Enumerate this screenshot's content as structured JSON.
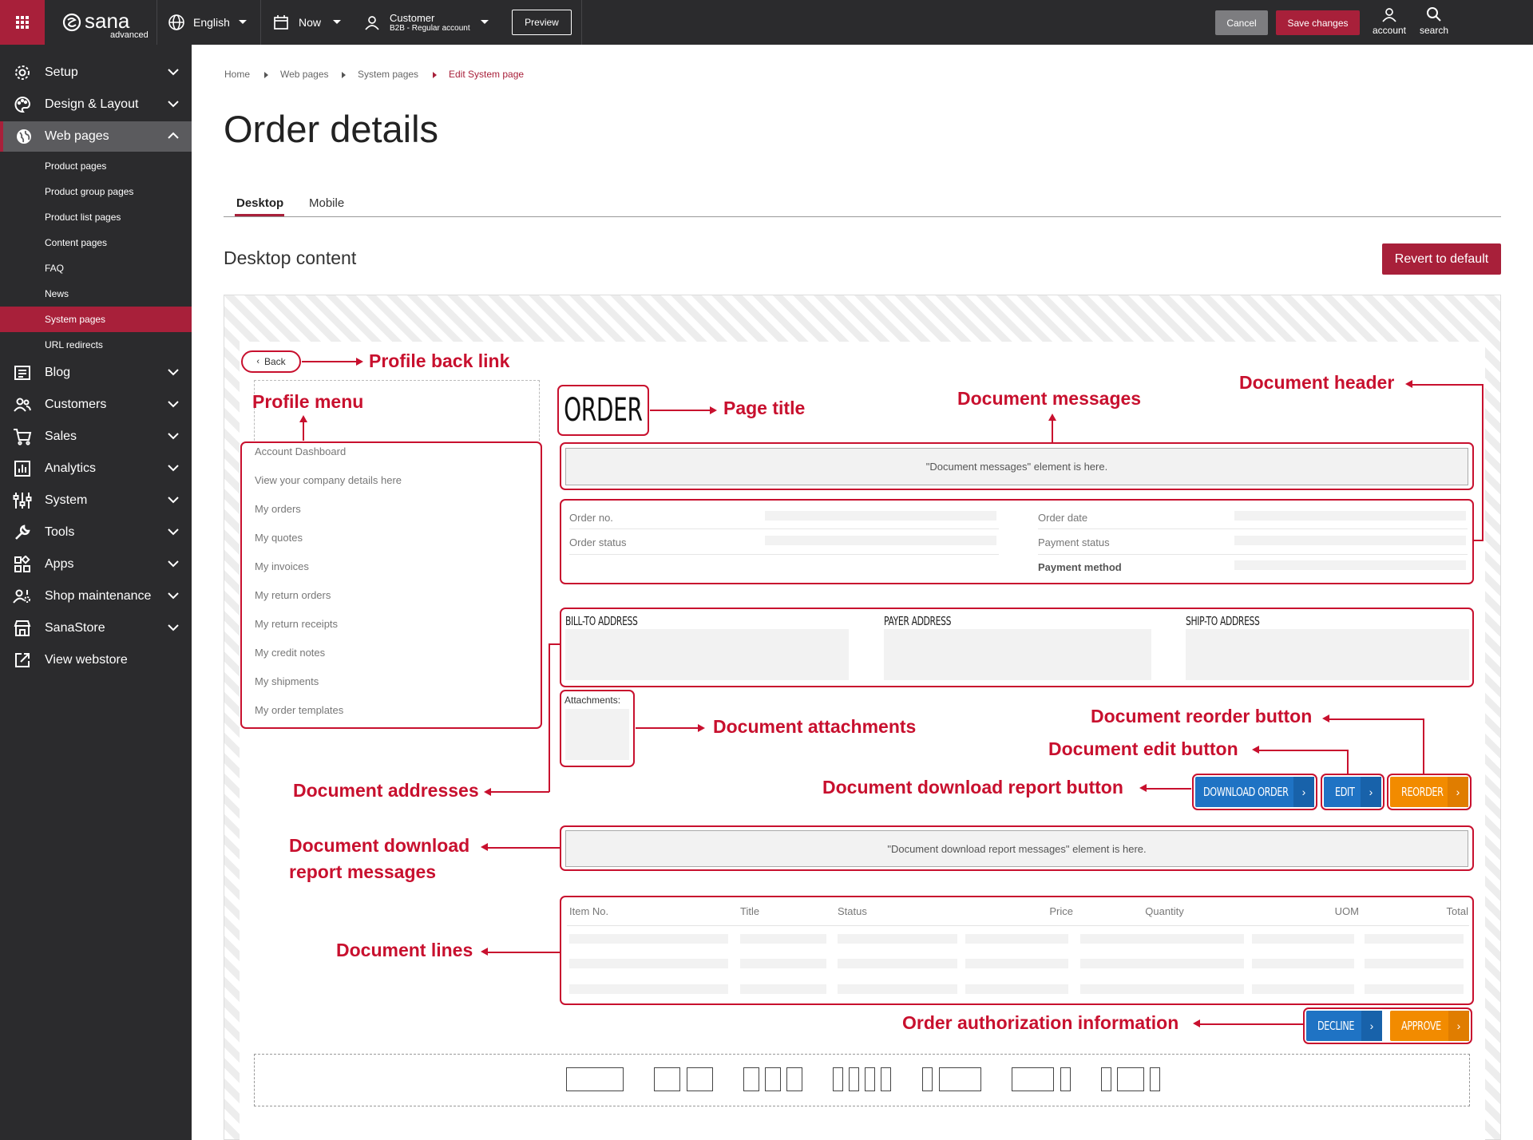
{
  "topbar": {
    "brand": "sana",
    "brand_sub": "advanced",
    "language": "English",
    "date": "Now",
    "customer_title": "Customer",
    "customer_sub": "B2B - Regular account",
    "preview": "Preview",
    "cancel": "Cancel",
    "save": "Save changes",
    "account": "account",
    "search": "search"
  },
  "sidebar": {
    "items": [
      {
        "label": "Setup",
        "icon": "gear-icon"
      },
      {
        "label": "Design & Layout",
        "icon": "palette-icon"
      },
      {
        "label": "Web pages",
        "icon": "globe-icon"
      },
      {
        "label": "Blog",
        "icon": "blog-icon"
      },
      {
        "label": "Customers",
        "icon": "people-icon"
      },
      {
        "label": "Sales",
        "icon": "cart-icon"
      },
      {
        "label": "Analytics",
        "icon": "chart-icon"
      },
      {
        "label": "System",
        "icon": "sliders-icon"
      },
      {
        "label": "Tools",
        "icon": "wrench-icon"
      },
      {
        "label": "Apps",
        "icon": "apps-icon"
      },
      {
        "label": "Shop maintenance",
        "icon": "maintenance-icon"
      },
      {
        "label": "SanaStore",
        "icon": "store-icon"
      },
      {
        "label": "View webstore",
        "icon": "external-link-icon"
      }
    ],
    "subitems": [
      "Product pages",
      "Product group pages",
      "Product list pages",
      "Content pages",
      "FAQ",
      "News",
      "System pages",
      "URL redirects"
    ]
  },
  "breadcrumb": [
    "Home",
    "Web pages",
    "System pages",
    "Edit System page"
  ],
  "page_title": "Order details",
  "tabs": [
    "Desktop",
    "Mobile"
  ],
  "section_title": "Desktop content",
  "revert": "Revert to default",
  "preview": {
    "back": "Back",
    "order_title": "ORDER",
    "menu": [
      "Account Dashboard",
      "View your company details here",
      "My orders",
      "My quotes",
      "My invoices",
      "My return orders",
      "My return receipts",
      "My credit notes",
      "My shipments",
      "My order templates"
    ],
    "messages_text": "\"Document messages\" element is here.",
    "header_fields": {
      "order_no": "Order no.",
      "order_status": "Order status",
      "order_date": "Order date",
      "payment_status": "Payment status",
      "payment_method": "Payment method"
    },
    "addresses": [
      "BILL-TO ADDRESS",
      "PAYER ADDRESS",
      "SHIP-TO ADDRESS"
    ],
    "attachments": "Attachments:",
    "buttons": {
      "download": "DOWNLOAD ORDER",
      "edit": "EDIT",
      "reorder": "REORDER",
      "decline": "DECLINE",
      "approve": "APPROVE"
    },
    "download_messages_text": "\"Document download report messages\" element is here.",
    "lines_columns": [
      "Item No.",
      "Title",
      "Status",
      "Price",
      "Quantity",
      "UOM",
      "Total"
    ]
  },
  "notes": {
    "back": "Profile back link",
    "menu": "Profile menu",
    "title": "Page title",
    "messages": "Document messages",
    "header": "Document header",
    "reorder": "Document reorder button",
    "edit": "Document edit button",
    "attachments": "Document attachments",
    "download": "Document download report button",
    "addresses": "Document addresses",
    "dl_messages_1": "Document download",
    "dl_messages_2": "report messages",
    "lines": "Document lines",
    "authorization": "Order authorization information"
  },
  "colors": {
    "accent": "#a8203a",
    "annotation": "#c8102e",
    "blue_button": "#1f73c4",
    "orange_button": "#f28b00",
    "dark": "#2b2b2d"
  }
}
